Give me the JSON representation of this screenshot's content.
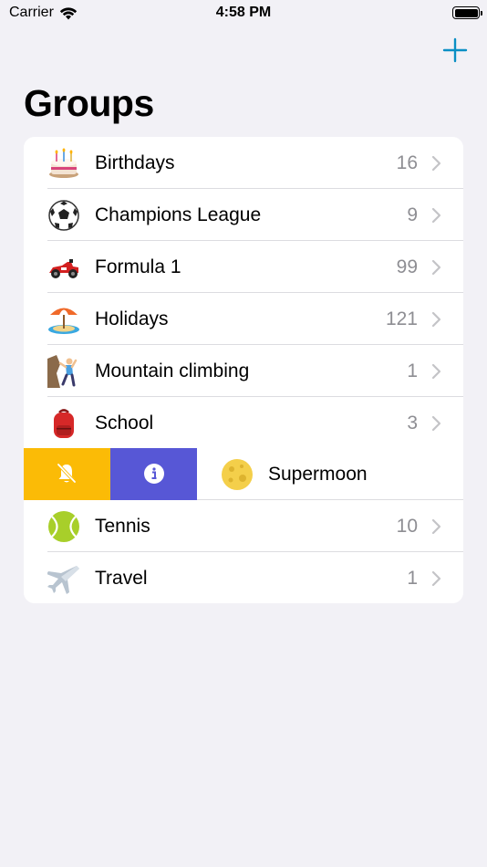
{
  "status_bar": {
    "carrier": "Carrier",
    "time": "4:58 PM"
  },
  "header": {
    "title": "Groups"
  },
  "colors": {
    "accent": "#0a8fc4",
    "mute_action": "#fbbb06",
    "info_action": "#5757d6",
    "count_gray": "#8e8e93",
    "background": "#f2f1f6"
  },
  "groups": [
    {
      "emoji_name": "birthday-cake-icon",
      "label": "Birthdays",
      "count": "16"
    },
    {
      "emoji_name": "soccer-ball-icon",
      "label": "Champions League",
      "count": "9"
    },
    {
      "emoji_name": "race-car-icon",
      "label": "Formula 1",
      "count": "99"
    },
    {
      "emoji_name": "beach-umbrella-icon",
      "label": "Holidays",
      "count": "121"
    },
    {
      "emoji_name": "climber-icon",
      "label": "Mountain climbing",
      "count": "1"
    },
    {
      "emoji_name": "backpack-icon",
      "label": "School",
      "count": "3"
    },
    {
      "emoji_name": "full-moon-icon",
      "label": "Supermoon",
      "count": ""
    },
    {
      "emoji_name": "tennis-ball-icon",
      "label": "Tennis",
      "count": "10"
    },
    {
      "emoji_name": "airplane-icon",
      "label": "Travel",
      "count": "1"
    }
  ],
  "swipe_actions": {
    "mute_icon": "bell-slash-icon",
    "info_icon": "info-circle-icon"
  }
}
